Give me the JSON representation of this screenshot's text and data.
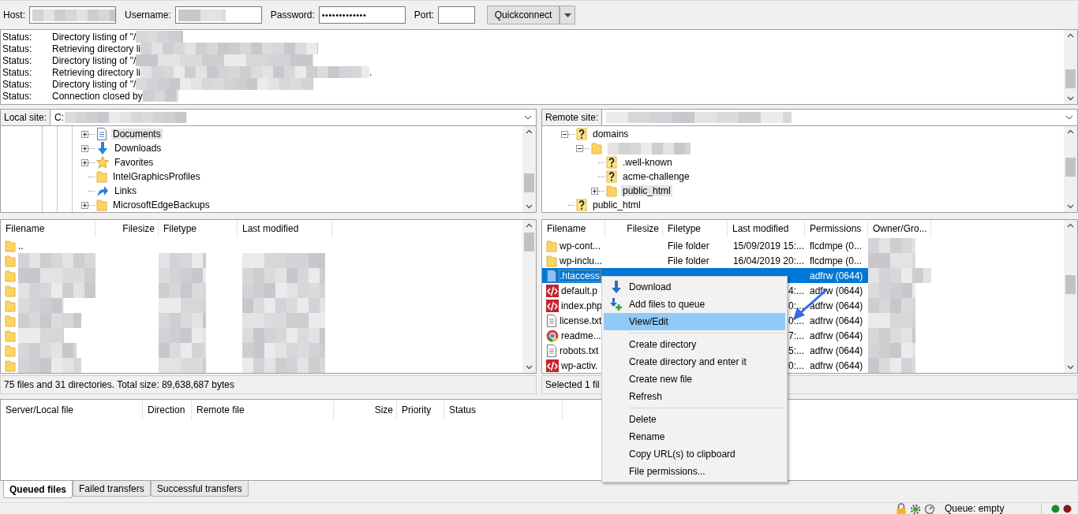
{
  "toolbar": {
    "host": {
      "label": "Host:",
      "redacted": true
    },
    "username": {
      "label": "Username:",
      "redacted": true
    },
    "password": {
      "label": "Password:",
      "value": "•••••••••••••"
    },
    "port": {
      "label": "Port:"
    },
    "quickconnect": "Quickconnect"
  },
  "log": [
    {
      "label": "Status:",
      "text": "Directory listing of \"/"
    },
    {
      "label": "Status:",
      "text": "Retrieving directory li"
    },
    {
      "label": "Status:",
      "text": "Directory listing of \"/"
    },
    {
      "label": "Status:",
      "text": "Retrieving directory li",
      "trail": "."
    },
    {
      "label": "Status:",
      "text": "Directory listing of \"/"
    },
    {
      "label": "Status:",
      "text": "Connection closed by"
    }
  ],
  "local": {
    "site_label": "Local site:",
    "path": "C:",
    "tree": [
      {
        "label": "Documents",
        "kind": "documents",
        "expandable": true,
        "expanded": false,
        "selected": true
      },
      {
        "label": "Downloads",
        "kind": "downloads",
        "expandable": true,
        "expanded": false,
        "selected": false
      },
      {
        "label": "Favorites",
        "kind": "favorites",
        "expandable": true,
        "expanded": false,
        "selected": false
      },
      {
        "label": "IntelGraphicsProfiles",
        "kind": "folder",
        "expandable": false,
        "selected": false
      },
      {
        "label": "Links",
        "kind": "links",
        "expandable": false,
        "selected": false
      },
      {
        "label": "MicrosoftEdgeBackups",
        "kind": "folder",
        "expandable": true,
        "expanded": false,
        "selected": false
      }
    ],
    "columns": [
      "Filename",
      "Filesize",
      "Filetype",
      "Last modified"
    ],
    "rows": [
      {
        "name": ".."
      },
      {
        "redacted": true
      },
      {
        "redacted": true
      },
      {
        "redacted": true
      },
      {
        "redacted": true
      },
      {
        "redacted": true
      },
      {
        "redacted": true
      },
      {
        "redacted": true
      },
      {
        "redacted": true
      }
    ],
    "status": "75 files and 31 directories. Total size: 89,638,687 bytes"
  },
  "remote": {
    "site_label": "Remote site:",
    "tree": [
      {
        "label": "domains",
        "kind": "unknown",
        "expandable": true,
        "expanded": true,
        "selected": false,
        "children": [
          {
            "redacted": true,
            "kind": "folder",
            "expandable": true,
            "expanded": true,
            "selected": false,
            "children": [
              {
                "label": ".well-known",
                "kind": "unknown",
                "expandable": false,
                "selected": false
              },
              {
                "label": "acme-challenge",
                "kind": "unknown",
                "expandable": false,
                "selected": false
              },
              {
                "label": "public_html",
                "kind": "folder",
                "expandable": true,
                "expanded": false,
                "selected": true
              }
            ]
          }
        ]
      },
      {
        "label": "public_html",
        "kind": "unknown",
        "expandable": false,
        "selected": false
      }
    ],
    "columns": [
      "Filename",
      "Filesize",
      "Filetype",
      "Last modified",
      "Permissions",
      "Owner/Gro..."
    ],
    "rows": [
      {
        "kind": "folder",
        "name": "wp-cont...",
        "type": "File folder",
        "modified": "15/09/2019 15:...",
        "permissions": "flcdmpe (0...",
        "selected": false
      },
      {
        "kind": "folder",
        "name": "wp-inclu...",
        "type": "File folder",
        "modified": "16/04/2019 20:...",
        "permissions": "flcdmpe (0...",
        "selected": false
      },
      {
        "kind": "file",
        "name": ".htaccess",
        "permissions": "adfrw (0644)",
        "selected": true
      },
      {
        "kind": "php",
        "name": "default.p",
        "modified": "4:...",
        "permissions": "adfrw (0644)",
        "selected": false
      },
      {
        "kind": "php",
        "name": "index.php",
        "modified": "0:...",
        "permissions": "adfrw (0644)",
        "selected": false
      },
      {
        "kind": "text",
        "name": "license.txt",
        "modified": "0:...",
        "permissions": "adfrw (0644)",
        "selected": false
      },
      {
        "kind": "web",
        "name": "readme...",
        "modified": "7:...",
        "permissions": "adfrw (0644)",
        "selected": false
      },
      {
        "kind": "text",
        "name": "robots.txt",
        "modified": "5:...",
        "permissions": "adfrw (0644)",
        "selected": false
      },
      {
        "kind": "php",
        "name": "wp-activ.",
        "modified": "0:...",
        "permissions": "adfrw (0644)",
        "selected": false
      }
    ],
    "status": "Selected 1 fil"
  },
  "context_menu": [
    [
      {
        "label": "Download",
        "selected": false
      },
      {
        "label": "Add files to queue",
        "selected": false
      },
      {
        "label": "View/Edit",
        "selected": true
      }
    ],
    [
      {
        "label": "Create directory",
        "selected": false
      },
      {
        "label": "Create directory and enter it",
        "selected": false
      },
      {
        "label": "Create new file",
        "selected": false
      },
      {
        "label": "Refresh",
        "selected": false
      }
    ],
    [
      {
        "label": "Delete",
        "selected": false
      },
      {
        "label": "Rename",
        "selected": false
      },
      {
        "label": "Copy URL(s) to clipboard",
        "selected": false
      },
      {
        "label": "File permissions...",
        "selected": false
      }
    ]
  ],
  "queue": {
    "columns": [
      "Server/Local file",
      "Direction",
      "Remote file",
      "Size",
      "Priority",
      "Status"
    ],
    "tabs": [
      {
        "label": "Queued files",
        "selected": true
      },
      {
        "label": "Failed transfers",
        "selected": false
      },
      {
        "label": "Successful transfers",
        "selected": false
      }
    ]
  },
  "status_bar": {
    "queue": "Queue: empty"
  }
}
